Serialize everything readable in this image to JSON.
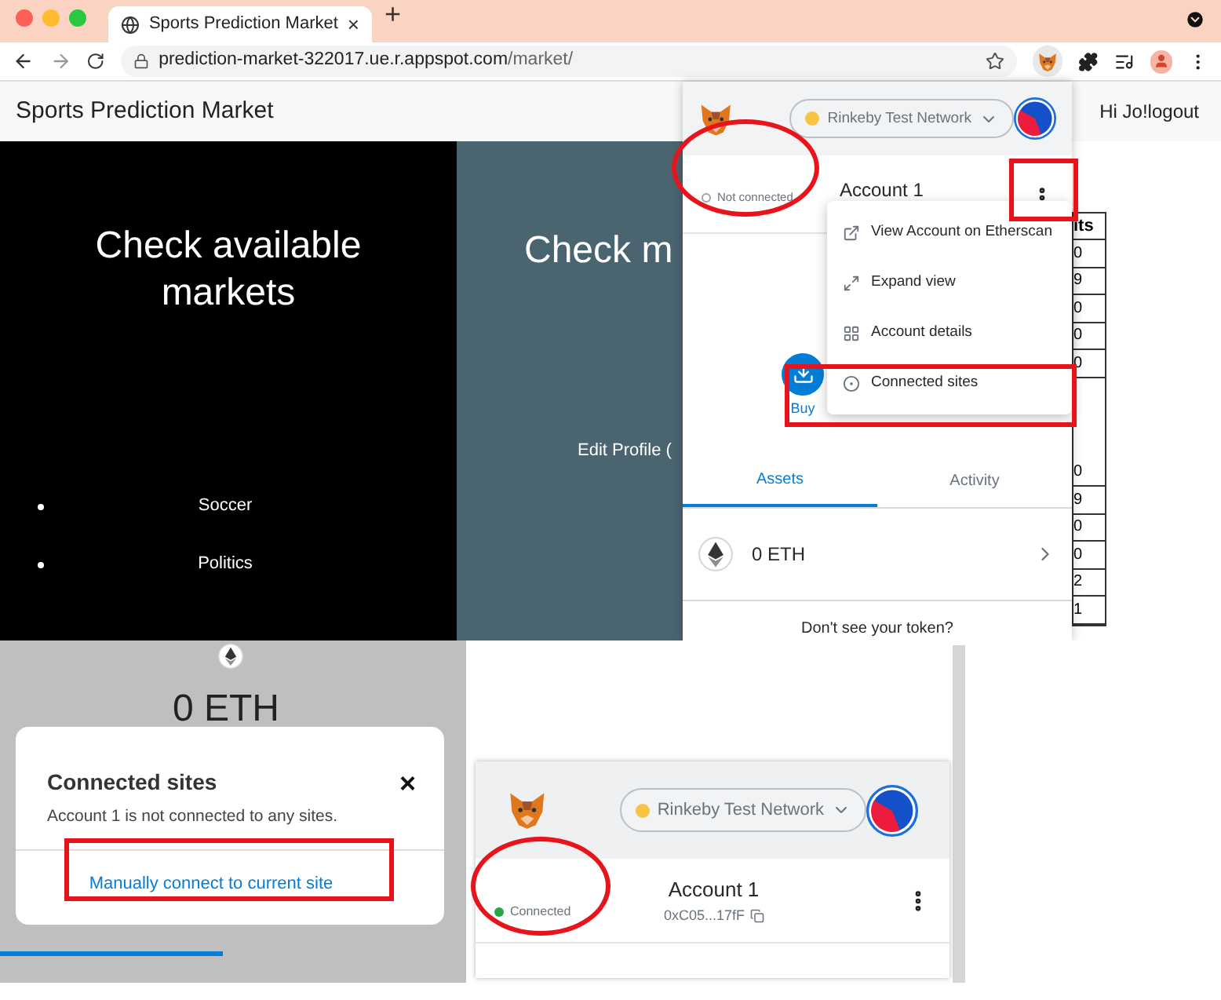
{
  "browser": {
    "tab": {
      "title": "Sports Prediction Market",
      "close": "×"
    },
    "new_tab": "+",
    "url": {
      "host": "prediction-market-322017.ue.r.appspot.com",
      "path": "/market/"
    }
  },
  "site": {
    "title": "Sports Prediction Market",
    "greeting": "Hi Jo!logout",
    "cards": [
      {
        "kind": "list",
        "title": "Check available markets",
        "items": [
          "Soccer",
          "Politics"
        ]
      },
      {
        "kind": "link",
        "title": "Check m",
        "link": "Edit Profile ("
      }
    ]
  },
  "partial_table": {
    "header": "its",
    "cells": [
      "0",
      "9",
      "0",
      "0",
      "0",
      "0",
      "9",
      "0",
      "0",
      "2",
      "1"
    ]
  },
  "wallet_popup": {
    "network": "Rinkeby Test Network",
    "status": {
      "label": "Not connected",
      "connected": false
    },
    "account": "Account 1",
    "menu": [
      {
        "label": "View Account on Etherscan"
      },
      {
        "label": "Expand view"
      },
      {
        "label": "Account details"
      },
      {
        "label": "Connected sites"
      }
    ],
    "action": "Buy",
    "tabs": [
      {
        "label": "Assets",
        "selected": true
      },
      {
        "label": "Activity",
        "selected": false
      }
    ],
    "asset": "0 ETH",
    "footer": "Don't see your token?"
  },
  "dialog": {
    "background_balance": "0 ETH",
    "title": "Connected sites",
    "close": "×",
    "message": "Account 1 is not connected to any sites.",
    "link": "Manually connect to current site"
  },
  "wallet_header": {
    "network": "Rinkeby Test Network",
    "status": {
      "label": "Connected",
      "connected": true
    },
    "account": "Account 1",
    "address": "0xC05...17fF"
  }
}
